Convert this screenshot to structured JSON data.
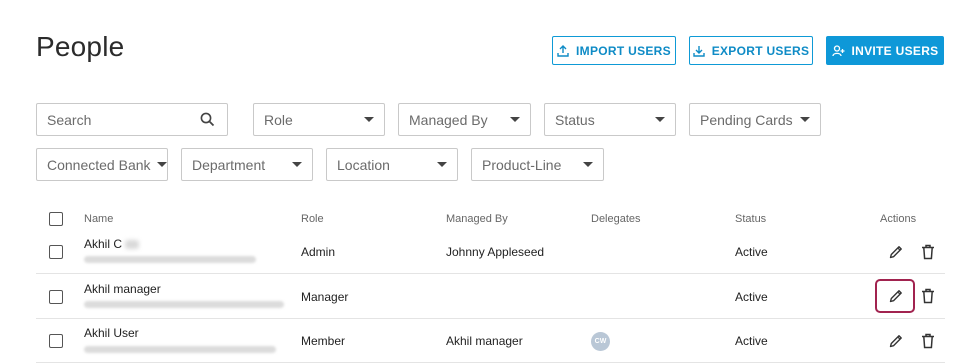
{
  "page": {
    "title": "People"
  },
  "actions": {
    "import_label": "IMPORT USERS",
    "export_label": "EXPORT USERS",
    "invite_label": "INVITE USERS"
  },
  "filters": {
    "search_placeholder": "Search",
    "role": "Role",
    "managed_by": "Managed By",
    "status": "Status",
    "pending_cards": "Pending Cards",
    "connected_bank": "Connected Bank",
    "department": "Department",
    "location": "Location",
    "product_line": "Product-Line"
  },
  "table": {
    "columns": {
      "name": "Name",
      "role": "Role",
      "managed_by": "Managed By",
      "delegates": "Delegates",
      "status": "Status",
      "actions": "Actions"
    },
    "rows": [
      {
        "name": "Akhil C",
        "role": "Admin",
        "managed_by": "Johnny Appleseed",
        "delegate": "",
        "status": "Active"
      },
      {
        "name": "Akhil manager",
        "role": "Manager",
        "managed_by": "",
        "delegate": "",
        "status": "Active"
      },
      {
        "name": "Akhil User",
        "role": "Member",
        "managed_by": "Akhil manager",
        "delegate": "CW",
        "status": "Active"
      }
    ]
  },
  "colors": {
    "accent": "#0e98d8",
    "focus": "#a1234f"
  },
  "icons": [
    "upload-icon",
    "download-icon",
    "add-user-icon",
    "search-icon",
    "pencil-icon",
    "trash-icon"
  ]
}
